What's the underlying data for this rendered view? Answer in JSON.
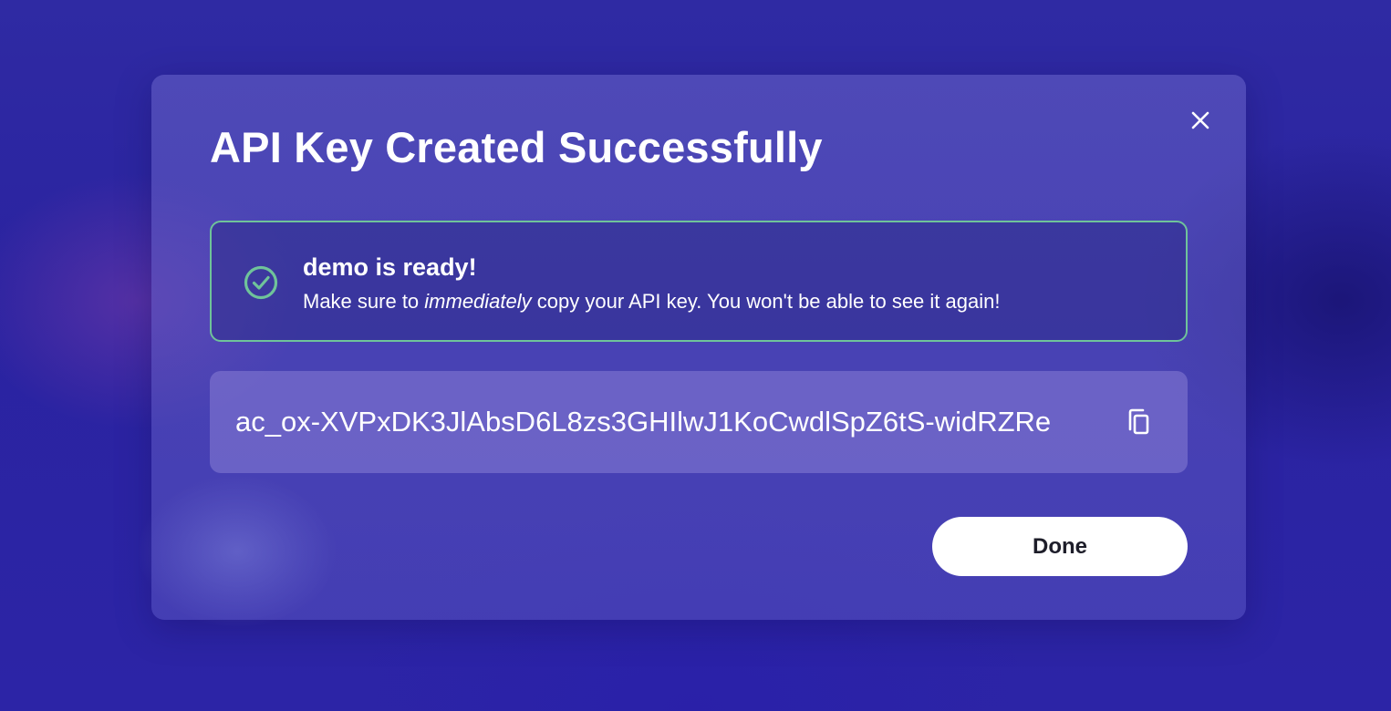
{
  "dialog": {
    "title": "API Key Created Successfully",
    "close_icon": "close-icon"
  },
  "alert": {
    "icon": "check-circle-icon",
    "border_color": "#6fc39a",
    "heading": "demo is ready!",
    "message_before": "Make sure to ",
    "message_emphasis": "immediately",
    "message_after": " copy your API key. You won't be able to see it again!"
  },
  "api_key": {
    "value": "ac_ox-XVPxDK3JlAbsD6L8zs3GHIlwJ1KoCwdlSpZ6tS-widRZRe",
    "copy_icon": "copy-icon"
  },
  "actions": {
    "done_label": "Done"
  }
}
